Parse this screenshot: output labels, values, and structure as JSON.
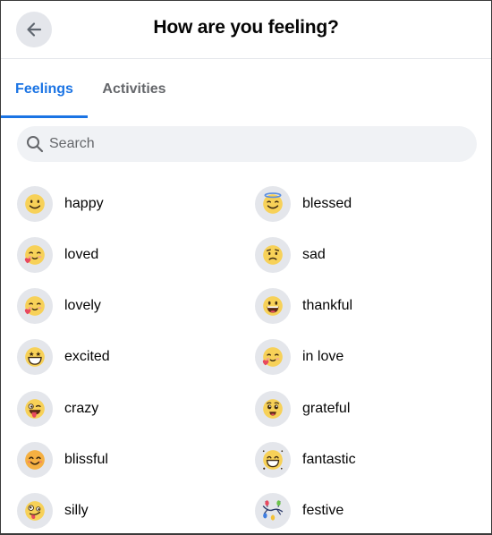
{
  "header": {
    "title": "How are you feeling?",
    "back_icon": "arrow-left-icon"
  },
  "tabs": [
    {
      "label": "Feelings",
      "active": true
    },
    {
      "label": "Activities",
      "active": false
    }
  ],
  "colors": {
    "accent": "#1b74e4",
    "tab_inactive": "#65676b",
    "circle_bg": "#e4e6eb",
    "search_bg": "#f0f2f5"
  },
  "search": {
    "placeholder": "Search",
    "value": ""
  },
  "feelings": [
    {
      "label": "happy",
      "icon": "slightly-smiling-face"
    },
    {
      "label": "blessed",
      "icon": "smiling-face-with-halo"
    },
    {
      "label": "loved",
      "icon": "smiling-face-with-heart"
    },
    {
      "label": "sad",
      "icon": "worried-face"
    },
    {
      "label": "lovely",
      "icon": "smiling-face-with-heart"
    },
    {
      "label": "thankful",
      "icon": "grinning-face"
    },
    {
      "label": "excited",
      "icon": "star-struck-face"
    },
    {
      "label": "in love",
      "icon": "smiling-face-with-heart"
    },
    {
      "label": "crazy",
      "icon": "winking-face-with-tongue"
    },
    {
      "label": "grateful",
      "icon": "face-holding-back-tears"
    },
    {
      "label": "blissful",
      "icon": "smiling-face-with-smiling-eyes"
    },
    {
      "label": "fantastic",
      "icon": "sparkling-grinning-face"
    },
    {
      "label": "silly",
      "icon": "zany-face"
    },
    {
      "label": "festive",
      "icon": "string-lights"
    }
  ]
}
